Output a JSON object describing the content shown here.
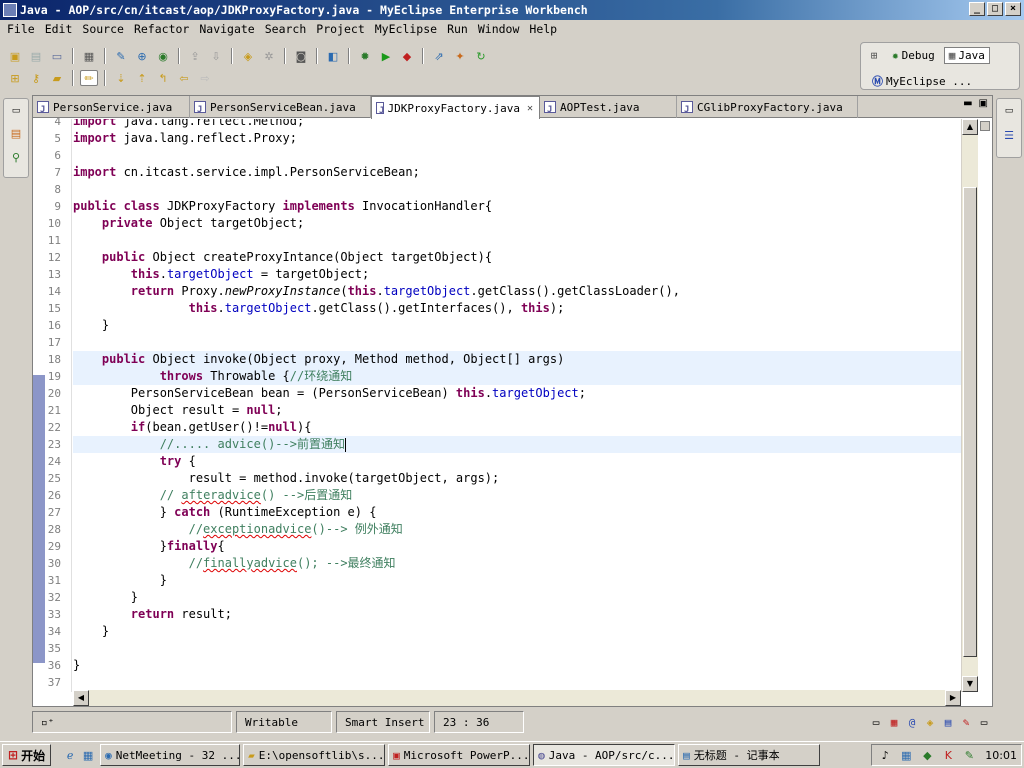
{
  "window": {
    "title": "Java - AOP/src/cn/itcast/aop/JDKProxyFactory.java - MyEclipse Enterprise Workbench",
    "controls": [
      "_",
      "□",
      "×"
    ]
  },
  "menu": [
    "File",
    "Edit",
    "Source",
    "Refactor",
    "Navigate",
    "Search",
    "Project",
    "MyEclipse",
    "Run",
    "Window",
    "Help"
  ],
  "perspectives": {
    "debug": "Debug",
    "java": "Java",
    "myeclipse": "MyEclipse ..."
  },
  "tabs": [
    {
      "label": "PersonService.java",
      "active": false
    },
    {
      "label": "PersonServiceBean.java",
      "active": false
    },
    {
      "label": "JDKProxyFactory.java",
      "active": true
    },
    {
      "label": "AOPTest.java",
      "active": false
    },
    {
      "label": "CGlibProxyFactory.java",
      "active": false
    }
  ],
  "editor": {
    "first_line": 4,
    "lines": [
      "import java.lang.reflect.Method;",
      "import java.lang.reflect.Proxy;",
      "",
      "import cn.itcast.service.impl.PersonServiceBean;",
      "",
      "public class JDKProxyFactory implements InvocationHandler{",
      "    private Object targetObject;",
      "",
      "    public Object createProxyIntance(Object targetObject){",
      "        this.targetObject = targetObject;",
      "        return Proxy.newProxyInstance(this.targetObject.getClass().getClassLoader(),",
      "                this.targetObject.getClass().getInterfaces(), this);",
      "    }",
      "",
      "    public Object invoke(Object proxy, Method method, Object[] args)",
      "            throws Throwable {//环绕通知",
      "        PersonServiceBean bean = (PersonServiceBean) this.targetObject;",
      "        Object result = null;",
      "        if(bean.getUser()!=null){",
      "            //..... advice()-->前置通知",
      "            try {",
      "                result = method.invoke(targetObject, args);",
      "            // afteradvice() -->后置通知",
      "            } catch (RuntimeException e) {",
      "                //exceptionadvice()--> 例外通知",
      "            }finally{",
      "                //finallyadvice(); -->最终通知",
      "            }",
      "        }",
      "        return result;",
      "    }",
      "",
      "}",
      ""
    ]
  },
  "status": {
    "mode": "Writable",
    "insert": "Smart Insert",
    "position": "23 : 36"
  },
  "taskbar": {
    "start": "开始",
    "tasks": [
      {
        "label": "NetMeeting - 32 ...",
        "active": false
      },
      {
        "label": "E:\\opensoftlib\\s...",
        "active": false
      },
      {
        "label": "Microsoft PowerP...",
        "active": false
      },
      {
        "label": "Java - AOP/src/c...",
        "active": true
      },
      {
        "label": "无标题 - 记事本",
        "active": false
      }
    ],
    "clock": "10:01"
  },
  "colors": {
    "keyword": "#7f0055",
    "field": "#0000c0",
    "comment": "#3f7f5f",
    "current_line": "#e8f2fe",
    "title_gradient_start": "#0a246a"
  }
}
